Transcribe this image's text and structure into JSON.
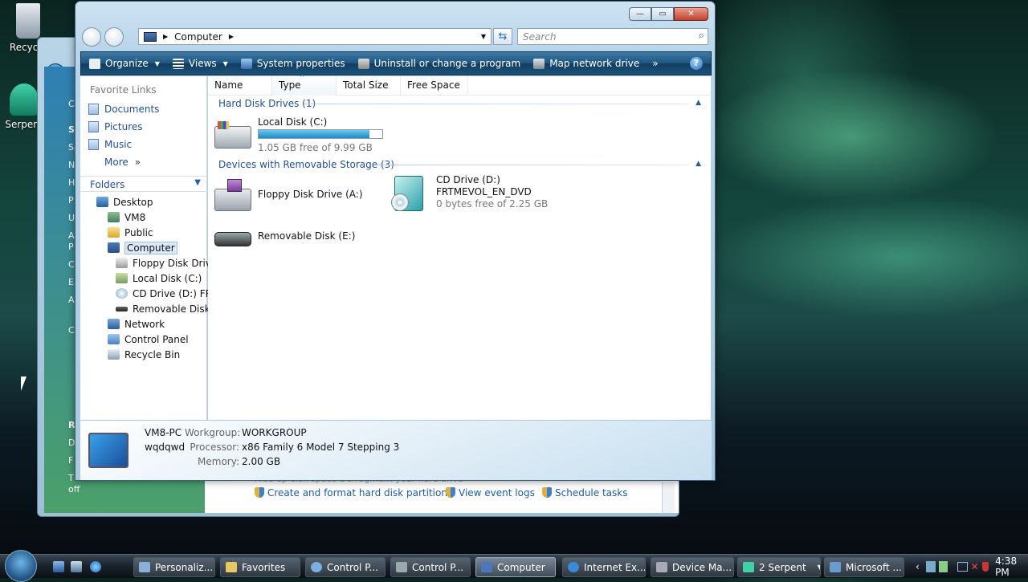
{
  "desktop": {
    "recycle_label": "Recycle",
    "serpent_label": "Serpent"
  },
  "bg_window": {
    "side_texts": [
      "C",
      "S",
      "Se",
      "N",
      "H",
      "P",
      "U",
      "A",
      "P",
      "C",
      "Ea",
      "A",
      "C",
      "R",
      "D",
      "F",
      "T",
      "off"
    ],
    "links": [
      "Create and format hard disk partitions",
      "View event logs",
      "Schedule tasks"
    ],
    "partial_top": "Free up disk space        Defragment your hard drive"
  },
  "window": {
    "address": "Computer",
    "search_placeholder": "Search",
    "title_buttons": {
      "min": "—",
      "max": "▭",
      "close": "✕"
    }
  },
  "toolbar": {
    "items": [
      "Organize",
      "Views",
      "System properties",
      "Uninstall or change a program",
      "Map network drive"
    ],
    "more": "»",
    "help": "?"
  },
  "favorites": {
    "heading": "Favorite Links",
    "links": [
      "Documents",
      "Pictures",
      "Music",
      "More"
    ],
    "more_arrows": "»"
  },
  "folders": {
    "heading": "Folders",
    "tree": [
      "Desktop",
      "VM8",
      "Public",
      "Computer",
      "Floppy Disk Drive",
      "Local Disk (C:)",
      "CD Drive (D:) FRTI",
      "Removable Disk (E",
      "Network",
      "Control Panel",
      "Recycle Bin"
    ]
  },
  "columns": [
    "Name",
    "Type",
    "Total Size",
    "Free Space"
  ],
  "groups": {
    "hdd": "Hard Disk Drives (1)",
    "removable": "Devices with Removable Storage (3)"
  },
  "drives": {
    "c": {
      "name": "Local Disk (C:)",
      "free": "1.05 GB free of 9.99 GB",
      "used_fraction": 0.895
    },
    "a": {
      "name": "Floppy Disk Drive (A:)"
    },
    "d": {
      "name": "CD Drive (D:)",
      "label": "FRTMEVOL_EN_DVD",
      "free": "0 bytes free of 2.25 GB"
    },
    "e": {
      "name": "Removable Disk (E:)"
    }
  },
  "details": {
    "pc_name": "VM8-PC",
    "user": "wqdqwd",
    "workgroup_label": "Workgroup:",
    "workgroup": "WORKGROUP",
    "processor_label": "Processor:",
    "processor": "x86 Family 6 Model 7 Stepping 3",
    "memory_label": "Memory:",
    "memory": "2.00 GB"
  },
  "taskbar": {
    "tasks": [
      "Personaliz...",
      "Favorites",
      "Control P...",
      "Control P...",
      "Computer",
      "Internet Ex...",
      "Device Ma...",
      "2 Serpent",
      "Microsoft ..."
    ],
    "clock": "4:38 PM"
  }
}
